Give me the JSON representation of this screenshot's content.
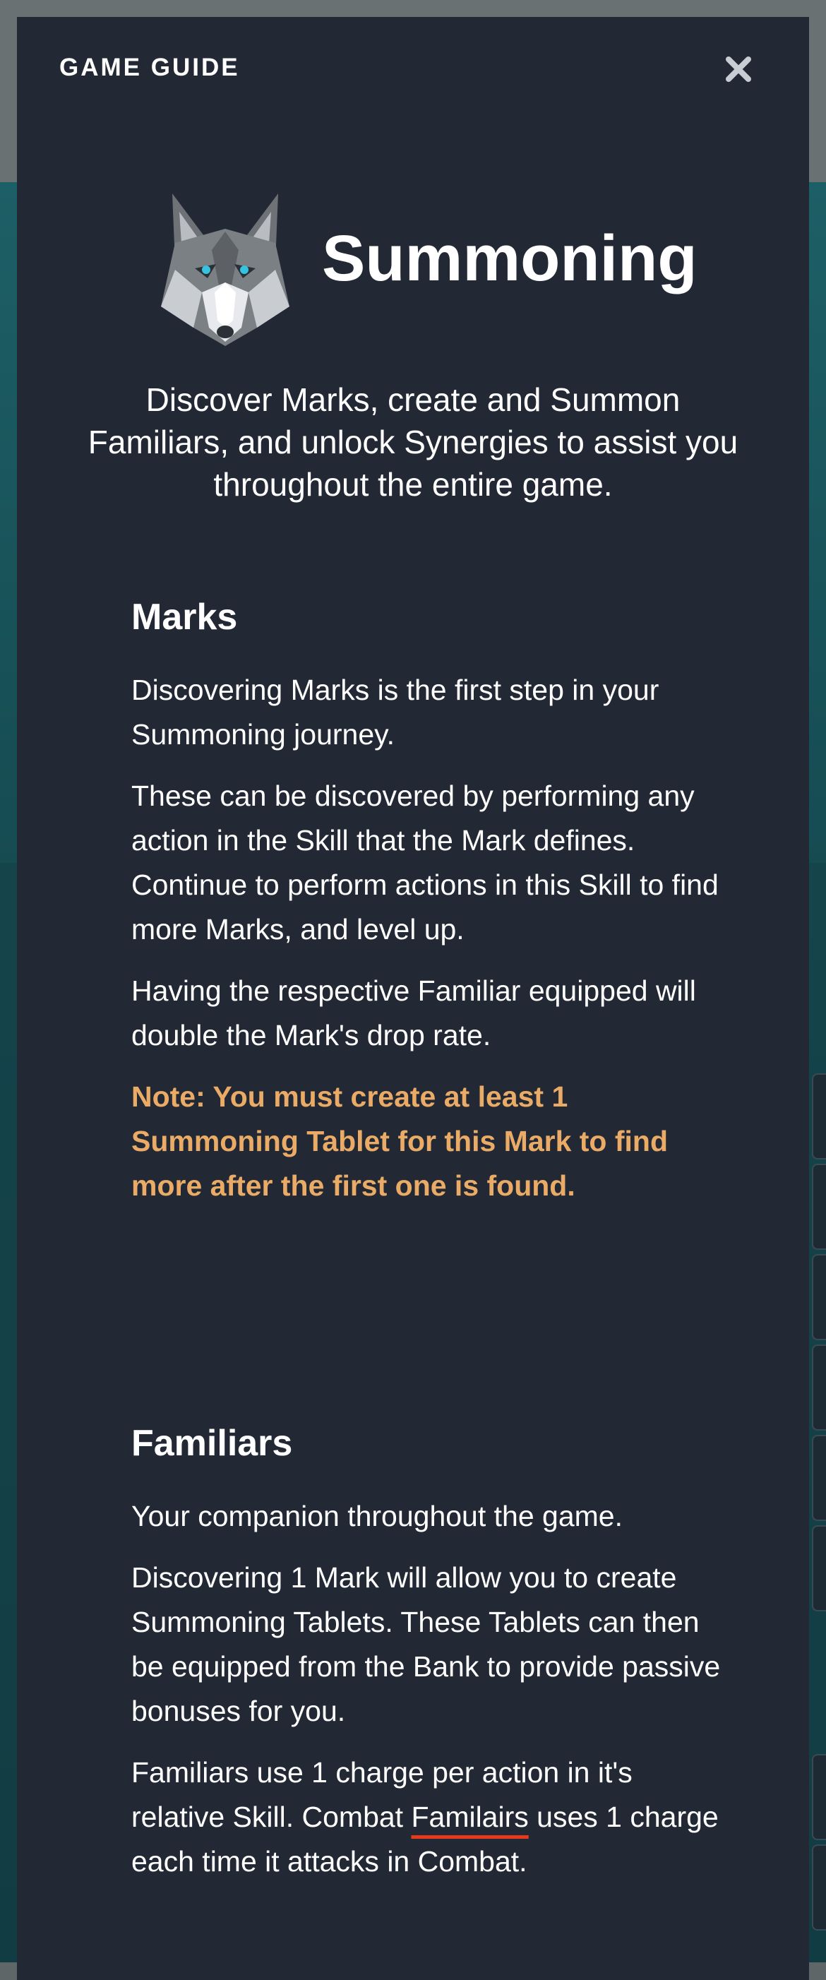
{
  "modal": {
    "title": "GAME GUIDE"
  },
  "hero": {
    "title": "Summoning",
    "icon": "wolf-icon",
    "intro": "Discover Marks, create and Summon Familiars, and unlock Synergies to assist you throughout the entire game."
  },
  "marks": {
    "heading": "Marks",
    "p1": "Discovering Marks is the first step in your Summoning journey.",
    "p2": "These can be discovered by performing any action in the Skill that the Mark defines. Continue to perform actions in this Skill to find more Marks, and level up.",
    "p3": "Having the respective Familiar equipped will double the Mark's drop rate.",
    "note": "Note: You must create at least 1 Summoning Tablet for this Mark to find more after the first one is found."
  },
  "familiars": {
    "heading": "Familiars",
    "p1": "Your companion throughout the game.",
    "p2": "Discovering 1 Mark will allow you to create Summoning Tablets. These Tablets can then be equipped from the Bank to provide passive bonuses for you.",
    "p3_before": "Familiars use 1 charge per action in it's relative Skill. Combat ",
    "p3_misspelled": "Familairs",
    "p3_after": " uses 1 charge each time it attacks in Combat."
  },
  "colors": {
    "modal_bg": "#232835",
    "note": "#e9ab66",
    "spellcheck_underline": "#e8391c"
  }
}
